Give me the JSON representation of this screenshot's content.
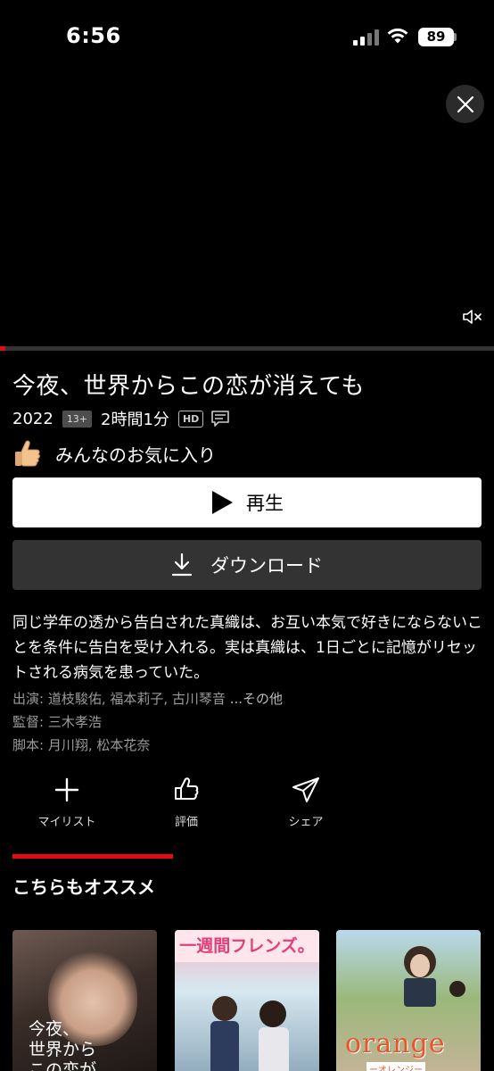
{
  "status": {
    "time": "6:56",
    "battery": "89"
  },
  "player": {
    "progress": 0.01,
    "accent": "#e50914"
  },
  "title": {
    "main": "今夜、世界からこの恋が消えても"
  },
  "meta": {
    "year": "2022",
    "rating": "13+",
    "duration": "2時間1分",
    "quality": "HD"
  },
  "favorite": {
    "label": "みんなのお気に入り"
  },
  "buttons": {
    "play": "再生",
    "download": "ダウンロード"
  },
  "synopsis": "同じ学年の透から告白された真織は、お互い本気で好きにならないことを条件に告白を受け入れる。実は真織は、1日ごとに記憶がリセットされる病気を患っていた。",
  "credits": {
    "cast_label": "出演:",
    "cast": "道枝駿佑, 福本莉子, 古川琴音",
    "more": "...その他",
    "director_label": "監督:",
    "director": "三木孝浩",
    "writer_label": "脚本:",
    "writers": "月川翔, 松本花奈"
  },
  "actions": {
    "mylist": "マイリスト",
    "rate": "評価",
    "share": "シェア"
  },
  "section": {
    "title": "こちらもオススメ"
  },
  "posters": [
    {
      "text": "今夜、\n世界から\nこの恋が"
    },
    {
      "text": "一週間フレンズ。"
    },
    {
      "text": "orange",
      "sub": "ーオレンジー"
    }
  ]
}
